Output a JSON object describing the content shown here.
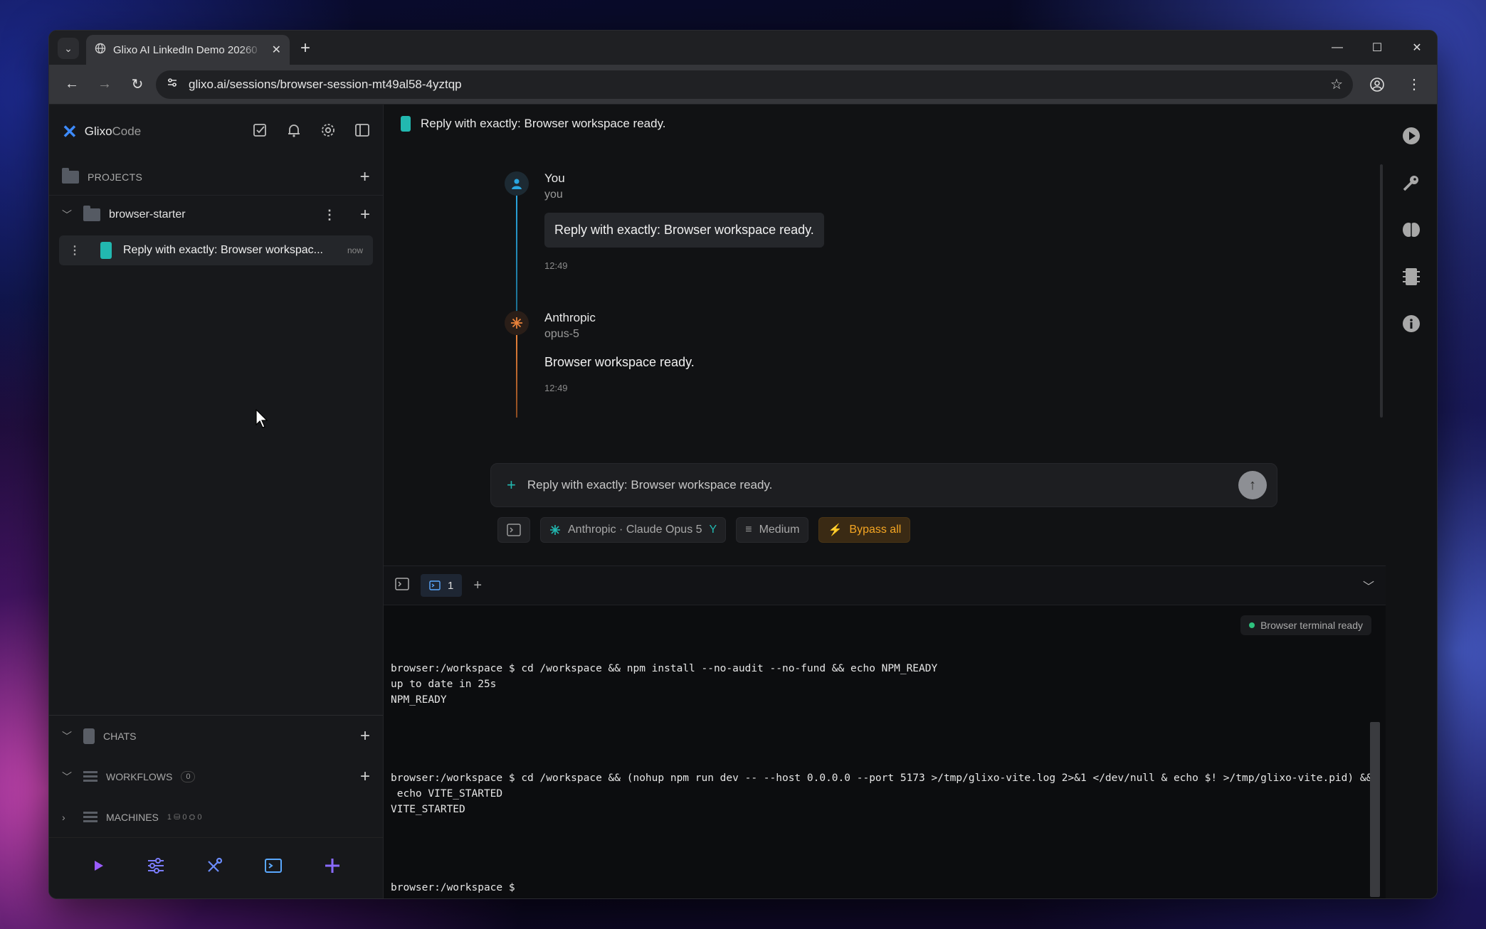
{
  "browser": {
    "tab_title": "Glixo AI LinkedIn Demo 20260",
    "url": "glixo.ai/sessions/browser-session-mt49al58-4yztqp"
  },
  "sidebar": {
    "brand_name": "Glixo",
    "brand_suffix": "Code",
    "projects_label": "PROJECTS",
    "project_name": "browser-starter",
    "session_title": "Reply with exactly: Browser workspac...",
    "session_time": "now",
    "chats_label": "CHATS",
    "workflows_label": "WORKFLOWS",
    "workflows_count": "0",
    "machines_label": "MACHINES",
    "machines_meta": "1 ⛁ 0 ⛭ 0"
  },
  "chat": {
    "header_title": "Reply with exactly: Browser workspace ready.",
    "messages": [
      {
        "sender": "You",
        "sub": "you",
        "text": "Reply with exactly: Browser workspace ready.",
        "time": "12:49"
      },
      {
        "sender": "Anthropic",
        "sub": "opus-5",
        "text": "Browser workspace ready.",
        "time": "12:49"
      }
    ],
    "composer_placeholder": "Reply with exactly: Browser workspace ready.",
    "chips": {
      "model": "Anthropic · Claude Opus 5",
      "effort": "Medium",
      "bypass": "Bypass all"
    }
  },
  "terminal": {
    "tab_label": "1",
    "status": "Browser terminal ready",
    "lines": [
      "browser:/workspace $ cd /workspace && npm install --no-audit --no-fund && echo NPM_READY",
      "up to date in 25s",
      "NPM_READY",
      "",
      "",
      "",
      "",
      "browser:/workspace $ cd /workspace && (nohup npm run dev -- --host 0.0.0.0 --port 5173 >/tmp/glixo-vite.log 2>&1 </dev/null & echo $! >/tmp/glixo-vite.pid) &&",
      " echo VITE_STARTED",
      "VITE_STARTED",
      "",
      "",
      "",
      "",
      "browser:/workspace $"
    ]
  },
  "colors": {
    "accent_teal": "#22b8b0",
    "anthropic_orange": "#e8823a",
    "bypass_orange": "#f5a623",
    "purple_icons": "#8a6bff"
  }
}
